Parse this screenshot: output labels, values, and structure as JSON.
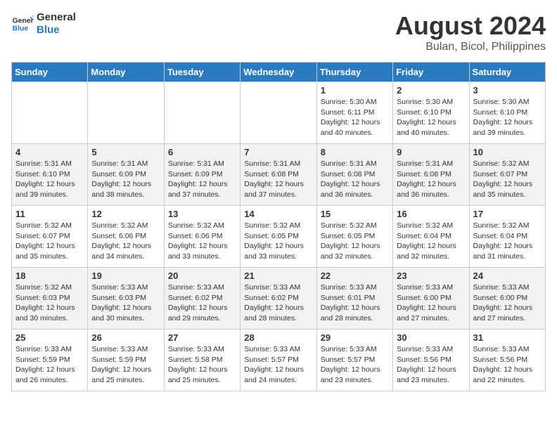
{
  "header": {
    "logo_line1": "General",
    "logo_line2": "Blue",
    "title": "August 2024",
    "subtitle": "Bulan, Bicol, Philippines"
  },
  "weekdays": [
    "Sunday",
    "Monday",
    "Tuesday",
    "Wednesday",
    "Thursday",
    "Friday",
    "Saturday"
  ],
  "weeks": [
    [
      {
        "day": "",
        "content": ""
      },
      {
        "day": "",
        "content": ""
      },
      {
        "day": "",
        "content": ""
      },
      {
        "day": "",
        "content": ""
      },
      {
        "day": "1",
        "content": "Sunrise: 5:30 AM\nSunset: 6:11 PM\nDaylight: 12 hours\nand 40 minutes."
      },
      {
        "day": "2",
        "content": "Sunrise: 5:30 AM\nSunset: 6:10 PM\nDaylight: 12 hours\nand 40 minutes."
      },
      {
        "day": "3",
        "content": "Sunrise: 5:30 AM\nSunset: 6:10 PM\nDaylight: 12 hours\nand 39 minutes."
      }
    ],
    [
      {
        "day": "4",
        "content": "Sunrise: 5:31 AM\nSunset: 6:10 PM\nDaylight: 12 hours\nand 39 minutes."
      },
      {
        "day": "5",
        "content": "Sunrise: 5:31 AM\nSunset: 6:09 PM\nDaylight: 12 hours\nand 38 minutes."
      },
      {
        "day": "6",
        "content": "Sunrise: 5:31 AM\nSunset: 6:09 PM\nDaylight: 12 hours\nand 37 minutes."
      },
      {
        "day": "7",
        "content": "Sunrise: 5:31 AM\nSunset: 6:08 PM\nDaylight: 12 hours\nand 37 minutes."
      },
      {
        "day": "8",
        "content": "Sunrise: 5:31 AM\nSunset: 6:08 PM\nDaylight: 12 hours\nand 36 minutes."
      },
      {
        "day": "9",
        "content": "Sunrise: 5:31 AM\nSunset: 6:08 PM\nDaylight: 12 hours\nand 36 minutes."
      },
      {
        "day": "10",
        "content": "Sunrise: 5:32 AM\nSunset: 6:07 PM\nDaylight: 12 hours\nand 35 minutes."
      }
    ],
    [
      {
        "day": "11",
        "content": "Sunrise: 5:32 AM\nSunset: 6:07 PM\nDaylight: 12 hours\nand 35 minutes."
      },
      {
        "day": "12",
        "content": "Sunrise: 5:32 AM\nSunset: 6:06 PM\nDaylight: 12 hours\nand 34 minutes."
      },
      {
        "day": "13",
        "content": "Sunrise: 5:32 AM\nSunset: 6:06 PM\nDaylight: 12 hours\nand 33 minutes."
      },
      {
        "day": "14",
        "content": "Sunrise: 5:32 AM\nSunset: 6:05 PM\nDaylight: 12 hours\nand 33 minutes."
      },
      {
        "day": "15",
        "content": "Sunrise: 5:32 AM\nSunset: 6:05 PM\nDaylight: 12 hours\nand 32 minutes."
      },
      {
        "day": "16",
        "content": "Sunrise: 5:32 AM\nSunset: 6:04 PM\nDaylight: 12 hours\nand 32 minutes."
      },
      {
        "day": "17",
        "content": "Sunrise: 5:32 AM\nSunset: 6:04 PM\nDaylight: 12 hours\nand 31 minutes."
      }
    ],
    [
      {
        "day": "18",
        "content": "Sunrise: 5:32 AM\nSunset: 6:03 PM\nDaylight: 12 hours\nand 30 minutes."
      },
      {
        "day": "19",
        "content": "Sunrise: 5:33 AM\nSunset: 6:03 PM\nDaylight: 12 hours\nand 30 minutes."
      },
      {
        "day": "20",
        "content": "Sunrise: 5:33 AM\nSunset: 6:02 PM\nDaylight: 12 hours\nand 29 minutes."
      },
      {
        "day": "21",
        "content": "Sunrise: 5:33 AM\nSunset: 6:02 PM\nDaylight: 12 hours\nand 28 minutes."
      },
      {
        "day": "22",
        "content": "Sunrise: 5:33 AM\nSunset: 6:01 PM\nDaylight: 12 hours\nand 28 minutes."
      },
      {
        "day": "23",
        "content": "Sunrise: 5:33 AM\nSunset: 6:00 PM\nDaylight: 12 hours\nand 27 minutes."
      },
      {
        "day": "24",
        "content": "Sunrise: 5:33 AM\nSunset: 6:00 PM\nDaylight: 12 hours\nand 27 minutes."
      }
    ],
    [
      {
        "day": "25",
        "content": "Sunrise: 5:33 AM\nSunset: 5:59 PM\nDaylight: 12 hours\nand 26 minutes."
      },
      {
        "day": "26",
        "content": "Sunrise: 5:33 AM\nSunset: 5:59 PM\nDaylight: 12 hours\nand 25 minutes."
      },
      {
        "day": "27",
        "content": "Sunrise: 5:33 AM\nSunset: 5:58 PM\nDaylight: 12 hours\nand 25 minutes."
      },
      {
        "day": "28",
        "content": "Sunrise: 5:33 AM\nSunset: 5:57 PM\nDaylight: 12 hours\nand 24 minutes."
      },
      {
        "day": "29",
        "content": "Sunrise: 5:33 AM\nSunset: 5:57 PM\nDaylight: 12 hours\nand 23 minutes."
      },
      {
        "day": "30",
        "content": "Sunrise: 5:33 AM\nSunset: 5:56 PM\nDaylight: 12 hours\nand 23 minutes."
      },
      {
        "day": "31",
        "content": "Sunrise: 5:33 AM\nSunset: 5:56 PM\nDaylight: 12 hours\nand 22 minutes."
      }
    ]
  ]
}
